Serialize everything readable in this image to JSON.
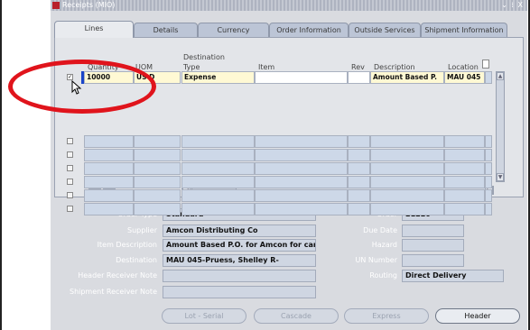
{
  "window": {
    "title": "Receipts (MIO)",
    "controls": "⌄ ⁞ X"
  },
  "tabs": [
    "Lines",
    "Details",
    "Currency",
    "Order Information",
    "Outside Services",
    "Shipment Information"
  ],
  "active_tab": "Lines",
  "columns": {
    "quantity": "Quantity",
    "uom": "UOM",
    "destination_type_1": "Destination",
    "destination_type_2": "Type",
    "item": "Item",
    "rev": "Rev",
    "description": "Description",
    "location": "Location"
  },
  "first_row": {
    "checked": true,
    "quantity": "10000",
    "uom": "US D",
    "destination_type": "Expense",
    "item": "",
    "rev": "",
    "description": "Amount Based P.",
    "location": "MAU 045"
  },
  "empty_rows": 6,
  "row_buttons": {
    "add": "+",
    "remove": "−"
  },
  "details_left": {
    "order_type": {
      "label": "Order Type",
      "value": "Standard"
    },
    "supplier": {
      "label": "Supplier",
      "value": "Amcon Distributing Co"
    },
    "item_description": {
      "label": "Item Description",
      "value": "Amount Based P.O. for Amcon for car"
    },
    "destination": {
      "label": "Destination",
      "value": "MAU 045-Pruess, Shelley R-"
    },
    "header_receiver_note": {
      "label": "Header Receiver Note",
      "value": ""
    },
    "shipment_receiver_note": {
      "label": "Shipment Receiver Note",
      "value": ""
    }
  },
  "details_right": {
    "order": {
      "label": "Order",
      "value": "21220"
    },
    "due_date": {
      "label": "Due Date",
      "value": ""
    },
    "hazard": {
      "label": "Hazard",
      "value": ""
    },
    "un_number": {
      "label": "UN Number",
      "value": ""
    },
    "routing": {
      "label": "Routing",
      "value": "Direct Delivery"
    }
  },
  "buttons": {
    "lot_serial": "Lot - Serial",
    "cascade": "Cascade",
    "express": "Express",
    "header": "Header"
  },
  "colors": {
    "annotation": "#e0141c",
    "focus": "#1a45c8",
    "highlight_field": "#fff9d4"
  }
}
